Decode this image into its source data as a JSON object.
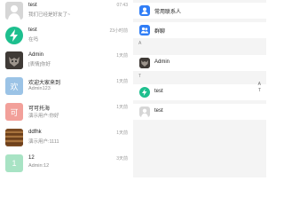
{
  "chats": [
    {
      "name": "test",
      "message": "我们已经是好友了~",
      "time": "07:43",
      "avatar": "default-person-icon",
      "avatar_color": "#cfcfcf"
    },
    {
      "name": "test",
      "message": "在吗",
      "time": "23小时前",
      "avatar": "lightning-icon",
      "avatar_color": "#1dbf8e"
    },
    {
      "name": "Admin",
      "message": "[表情]你好",
      "time": "1天前",
      "avatar": "wolf-photo-icon",
      "avatar_color": "#5a4f45"
    },
    {
      "name": "欢迎大家来到",
      "message": "Admin123",
      "time": "1天前",
      "avatar": "text-avatar",
      "avatar_text": "欢",
      "avatar_color": "#9bc3e6"
    },
    {
      "name": "可可托海",
      "message": "演示用户:你好",
      "time": "1天前",
      "avatar": "text-avatar",
      "avatar_text": "可",
      "avatar_color": "#f2a09a"
    },
    {
      "name": "ddfhk",
      "message": "演示用户:1111",
      "time": "1天前",
      "avatar": "wood-photo-icon",
      "avatar_color": "#8b5a2b"
    },
    {
      "name": "12",
      "message": "Admin:12",
      "time": "3天前",
      "avatar": "text-avatar",
      "avatar_text": "1",
      "avatar_color": "#a8e3c4"
    }
  ],
  "contacts": {
    "top_items": [
      {
        "label": "常用联系人",
        "icon": "person-icon",
        "color": "#2f7df6"
      },
      {
        "label": "群聊",
        "icon": "group-icon",
        "color": "#2f7df6"
      }
    ],
    "sections": [
      {
        "letter": "A",
        "items": [
          {
            "label": "Admin",
            "icon": "wolf-photo-icon",
            "color": "#5a4f45"
          }
        ]
      },
      {
        "letter": "T",
        "items": [
          {
            "label": "test",
            "icon": "lightning-icon",
            "color": "#1dbf8e"
          },
          {
            "label": "test",
            "icon": "default-person-icon",
            "color": "#cfcfcf"
          }
        ]
      }
    ],
    "index": [
      "A",
      "T"
    ]
  }
}
